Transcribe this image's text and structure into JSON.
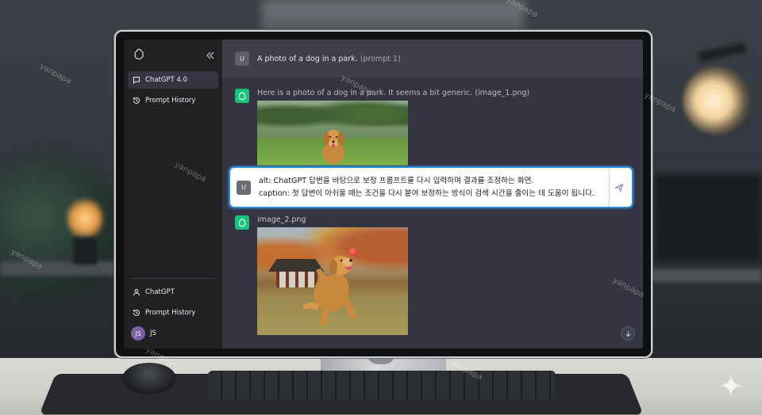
{
  "sidebar": {
    "top_items": [
      {
        "label": "ChatGPT 4.0",
        "icon": "chat-icon",
        "active": true
      },
      {
        "label": "Prompt History",
        "icon": "history-icon",
        "active": false
      }
    ],
    "bottom_items": [
      {
        "label": "ChatGPT",
        "icon": "user-icon"
      },
      {
        "label": "Prompt History",
        "icon": "history-icon"
      }
    ],
    "user": {
      "initials": "JS",
      "name": "JS"
    }
  },
  "conversation": {
    "user_message": {
      "avatar": "U",
      "text": "A photo of a dog in a park.",
      "suffix": "(prompt 1)"
    },
    "bot_message_1": {
      "text": "Here is a photo of a dog in a park. It seems a bit generic. (image_1.png)"
    },
    "bot_message_2": {
      "text": "image_2.png"
    }
  },
  "input": {
    "avatar": "U",
    "line1": "alt: ChatGPT 답변을 바탕으로 보정 프롬프트를 다시 입력하며 결과를 조정하는 화면.",
    "line2": "caption: 첫 답변이 아쉬울 때는 조건을 다시 붙여 보정하는 방식이 검색 시간을 줄이는 데 도움이 됩니다."
  },
  "watermark": "yanpapa",
  "colors": {
    "sidebar_bg": "#202123",
    "main_bg": "#343541",
    "user_row_bg": "#3e3f4b",
    "gpt_green": "#19c37d",
    "input_border": "#2e8bd8",
    "avatar_purple": "#7a62a3"
  }
}
